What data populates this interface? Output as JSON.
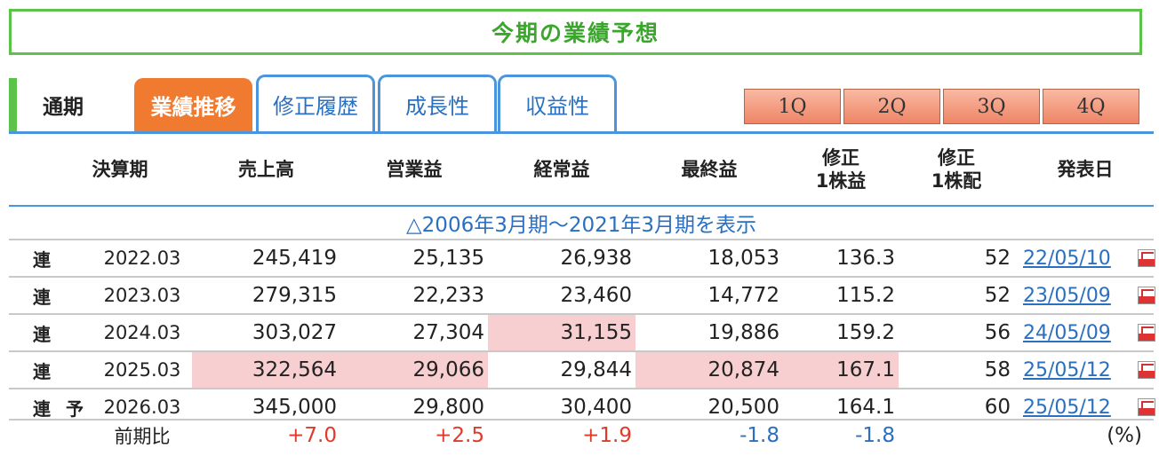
{
  "title": "今期の業績予想",
  "tabs": {
    "plain": "通期",
    "active": "業績推移",
    "others": [
      "修正履歴",
      "成長性",
      "収益性"
    ],
    "quarters": [
      "1Q",
      "2Q",
      "3Q",
      "4Q"
    ]
  },
  "headers": {
    "period": "決算期",
    "sales": "売上高",
    "operating": "営業益",
    "ordinary": "経常益",
    "net": "最終益",
    "eps_line1": "修正",
    "eps_line2": "1株益",
    "dps_line1": "修正",
    "dps_line2": "1株配",
    "date": "発表日"
  },
  "expand_link": "△2006年3月期～2021年3月期を表示",
  "rows": [
    {
      "kind": "連",
      "yosou": "",
      "period": "2022.03",
      "sales": "245,419",
      "operating": "25,135",
      "ordinary": "26,938",
      "net": "18,053",
      "eps": "136.3",
      "dps": "52",
      "date": "22/05/10"
    },
    {
      "kind": "連",
      "yosou": "",
      "period": "2023.03",
      "sales": "279,315",
      "operating": "22,233",
      "ordinary": "23,460",
      "net": "14,772",
      "eps": "115.2",
      "dps": "52",
      "date": "23/05/09"
    },
    {
      "kind": "連",
      "yosou": "",
      "period": "2024.03",
      "sales": "303,027",
      "operating": "27,304",
      "ordinary": "31,155",
      "net": "19,886",
      "eps": "159.2",
      "dps": "56",
      "date": "24/05/09"
    },
    {
      "kind": "連",
      "yosou": "",
      "period": "2025.03",
      "sales": "322,564",
      "operating": "29,066",
      "ordinary": "29,844",
      "net": "20,874",
      "eps": "167.1",
      "dps": "58",
      "date": "25/05/12"
    },
    {
      "kind": "連",
      "yosou": "予",
      "period": "2026.03",
      "sales": "345,000",
      "operating": "29,800",
      "ordinary": "30,400",
      "net": "20,500",
      "eps": "164.1",
      "dps": "60",
      "date": "25/05/12"
    }
  ],
  "ratio": {
    "label": "前期比",
    "sales": "+7.0",
    "operating": "+2.5",
    "ordinary": "+1.9",
    "net": "-1.8",
    "eps": "-1.8",
    "unit": "(%)"
  },
  "colors": {
    "title_green": "#3aa72c",
    "tab_orange": "#ef7a30",
    "tab_blue": "#4b95dc",
    "highlight_pink": "#f7cfd0",
    "positive_red": "#e03a2a",
    "negative_blue": "#2a6fc0"
  }
}
